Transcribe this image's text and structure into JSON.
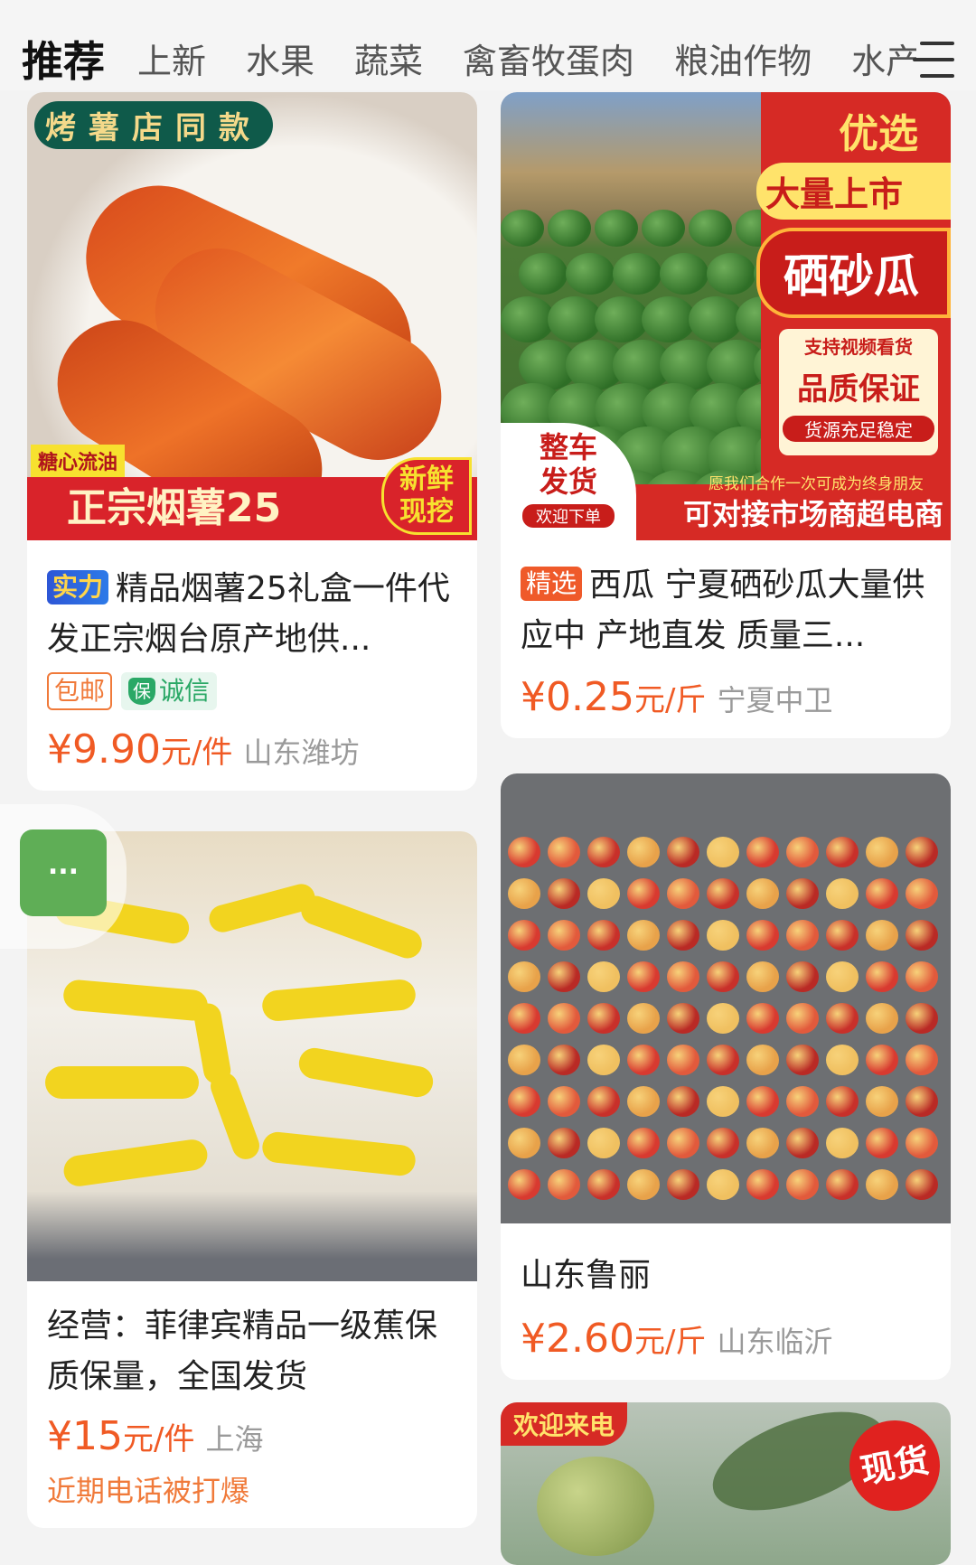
{
  "tabs": [
    "推荐",
    "上新",
    "水果",
    "蔬菜",
    "禽畜牧蛋肉",
    "粮油作物",
    "水产"
  ],
  "menu_icon": "menu-icon",
  "colors": {
    "accent": "#f05a24",
    "tag_orange": "#f07a3a",
    "credit_green": "#2aa866"
  },
  "cards": [
    {
      "image_texts": [
        "烤薯店同款",
        "糖心流油",
        "正宗烟薯25",
        "新鲜现挖"
      ],
      "badge": "实力",
      "title": "精品烟薯25礼盒一件代发正宗烟台原产地供...",
      "tag_post": "包邮",
      "tag_credit": "诚信",
      "credit_icon_char": "保",
      "price": "¥9.90",
      "unit": "元/件",
      "location": "山东潍坊"
    },
    {
      "image_texts": [
        "优选",
        "大量上市",
        "硒砂瓜",
        "支持视频看货",
        "品质保证",
        "货源充足稳定",
        "整车发货",
        "欢迎下单",
        "愿我们合作一次可成为终身朋友",
        "可对接市场商超电商"
      ],
      "badge": "精选",
      "title": "西瓜 宁夏硒砂瓜大量供应中 产地直发 质量三...",
      "price": "¥0.25",
      "unit": "元/斤",
      "location": "宁夏中卫"
    },
    {
      "title": "经营：菲律宾精品一级蕉保质保量，全国发货",
      "price": "¥15",
      "unit": "元/件",
      "location": "上海",
      "extra": "近期电话被打爆"
    },
    {
      "title": "山东鲁丽",
      "price": "¥2.60",
      "unit": "元/斤",
      "location": "山东临沂"
    },
    {
      "image_texts": [
        "欢迎来电",
        "现货"
      ]
    }
  ],
  "floating_button": "..."
}
